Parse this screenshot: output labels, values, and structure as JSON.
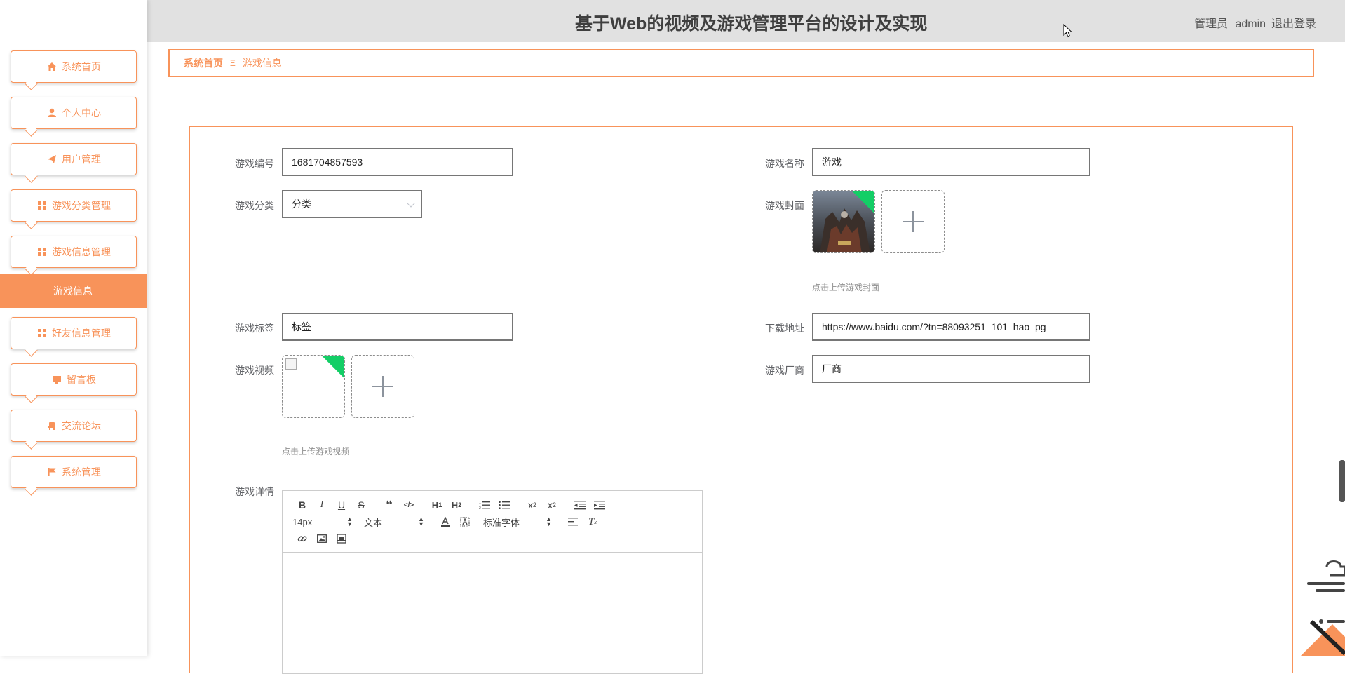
{
  "header": {
    "title": "基于Web的视频及游戏管理平台的设计及实现",
    "user_role": "管理员",
    "user_name": "admin",
    "logout": "退出登录"
  },
  "sidebar": {
    "items": [
      {
        "label": "系统首页",
        "icon": "home-icon"
      },
      {
        "label": "个人中心",
        "icon": "user-icon"
      },
      {
        "label": "用户管理",
        "icon": "send-icon"
      },
      {
        "label": "游戏分类管理",
        "icon": "grid-icon"
      },
      {
        "label": "游戏信息管理",
        "icon": "grid-icon"
      },
      {
        "label": "好友信息管理",
        "icon": "grid-icon"
      },
      {
        "label": "留言板",
        "icon": "monitor-icon"
      },
      {
        "label": "交流论坛",
        "icon": "chair-icon"
      },
      {
        "label": "系统管理",
        "icon": "flag-icon"
      }
    ],
    "active_sub": "游戏信息",
    "accent": "#f8935a"
  },
  "breadcrumb": {
    "home": "系统首页",
    "separator": "Ξ",
    "current": "游戏信息"
  },
  "form": {
    "game_no": {
      "label": "游戏编号",
      "value": "1681704857593"
    },
    "game_name": {
      "label": "游戏名称",
      "value": "游戏"
    },
    "category": {
      "label": "游戏分类",
      "value": "分类"
    },
    "cover": {
      "label": "游戏封面",
      "hint": "点击上传游戏封面"
    },
    "tags": {
      "label": "游戏标签",
      "value": "标签"
    },
    "download": {
      "label": "下载地址",
      "value": "https://www.baidu.com/?tn=88093251_101_hao_pg"
    },
    "video": {
      "label": "游戏视频",
      "hint": "点击上传游戏视频"
    },
    "vendor": {
      "label": "游戏厂商",
      "value": "厂商"
    },
    "details": {
      "label": "游戏详情"
    }
  },
  "editor": {
    "row1": [
      "B",
      "I",
      "U",
      "S",
      "❝",
      "</>",
      "H1",
      "H2",
      "ol",
      "ul",
      "x₂",
      "x²",
      "outdent",
      "indent"
    ],
    "font_size": "14px",
    "text_type": "文本",
    "font_family": "标准字体"
  }
}
